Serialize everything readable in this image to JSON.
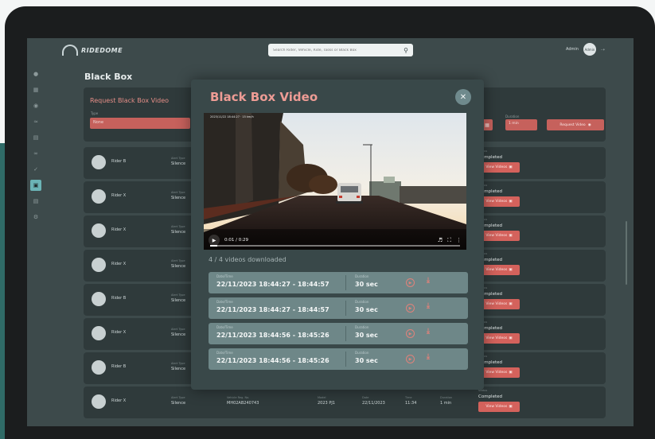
{
  "app": {
    "logo_text": "RIDEDOME",
    "search_placeholder": "Search Rider, Vehicle, Ride, Tasks or Black Box",
    "user_name": "Admin",
    "avatar_initials": "Admin"
  },
  "page": {
    "title": "Black Box"
  },
  "request_panel": {
    "title": "Request Black Box Video",
    "type_label": "Type",
    "type_value": "None",
    "duration_label": "Duration",
    "duration_value": "1 min",
    "request_button": "Request Video"
  },
  "rows": [
    {
      "name": "Rider B",
      "type_label": "Alert Type",
      "type": "Silence",
      "status_label": "Status",
      "status": "Completed",
      "view_label": "View Videos"
    },
    {
      "name": "Rider X",
      "type_label": "Alert Type",
      "type": "Silence",
      "status_label": "Status",
      "status": "Completed",
      "view_label": "View Videos"
    },
    {
      "name": "Rider X",
      "type_label": "Alert Type",
      "type": "Silence",
      "status_label": "Status",
      "status": "Completed",
      "view_label": "View Videos"
    },
    {
      "name": "Rider X",
      "type_label": "Alert Type",
      "type": "Silence",
      "status_label": "Status",
      "status": "Completed",
      "view_label": "View Videos"
    },
    {
      "name": "Rider B",
      "type_label": "Alert Type",
      "type": "Silence",
      "status_label": "Status",
      "status": "Completed",
      "view_label": "View Videos"
    },
    {
      "name": "Rider X",
      "type_label": "Alert Type",
      "type": "Silence",
      "status_label": "Status",
      "status": "Completed",
      "view_label": "View Videos"
    },
    {
      "name": "Rider B",
      "type_label": "Alert Type",
      "type": "Silence",
      "status_label": "Status",
      "status": "Completed",
      "view_label": "View Videos"
    },
    {
      "name": "Rider X",
      "type_label": "Alert Type",
      "type": "Silence",
      "status_label": "Status",
      "status": "Completed",
      "view_label": "View Videos",
      "vehicle_label": "Vehicle Reg. No.",
      "vehicle": "MH02AB240743",
      "model_label": "Model",
      "model": "2023 PJ1",
      "date_label": "Date",
      "date": "22/11/2023",
      "time_label": "Time",
      "time": "11:34",
      "dur_label": "Duration",
      "dur": "1 min"
    }
  ],
  "modal": {
    "title": "Black Box Video",
    "close_icon": "close-icon",
    "video_stamp": "2023/11/22 18:44:27 · 15 km/h",
    "time_display": "0:01 / 0:29",
    "download_status": "4 / 4 videos downloaded",
    "clips": [
      {
        "dt_label": "Date/Time",
        "dt": "22/11/2023 18:44:27 - 18:44:57",
        "dur_label": "Duration",
        "dur": "30 sec"
      },
      {
        "dt_label": "Date/Time",
        "dt": "22/11/2023 18:44:27 - 18:44:57",
        "dur_label": "Duration",
        "dur": "30 sec"
      },
      {
        "dt_label": "Date/Time",
        "dt": "22/11/2023 18:44:56 - 18:45:26",
        "dur_label": "Duration",
        "dur": "30 sec"
      },
      {
        "dt_label": "Date/Time",
        "dt": "22/11/2023 18:44:56 - 18:45:26",
        "dur_label": "Duration",
        "dur": "30 sec"
      }
    ],
    "progress_fraction": 0.03
  },
  "colors": {
    "accent": "#d4625c",
    "title_pink": "#ee9c95",
    "panel": "#2f3a3b",
    "screen_bg": "#3d4a4b"
  }
}
